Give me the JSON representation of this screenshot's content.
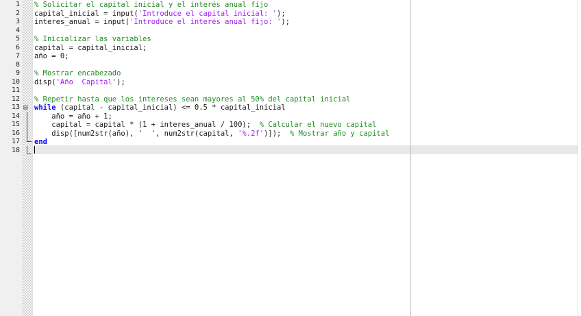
{
  "editor": {
    "line_numbers": [
      "1",
      "2",
      "3",
      "4",
      "5",
      "6",
      "7",
      "8",
      "9",
      "10",
      "11",
      "12",
      "13",
      "14",
      "15",
      "16",
      "17",
      "18"
    ],
    "current_line": "18",
    "lines": [
      [
        {
          "t": "comment",
          "v": "% Solicitar el capital inicial y el interés anual fijo"
        }
      ],
      [
        {
          "t": "text",
          "v": "capital_inicial = input("
        },
        {
          "t": "string",
          "v": "'Introduce el capital inicial: '"
        },
        {
          "t": "text",
          "v": ");"
        }
      ],
      [
        {
          "t": "text",
          "v": "interes_anual = input("
        },
        {
          "t": "string",
          "v": "'Introduce el interés anual fijo: '"
        },
        {
          "t": "text",
          "v": ");"
        }
      ],
      [],
      [
        {
          "t": "comment",
          "v": "% Inicializar las variables"
        }
      ],
      [
        {
          "t": "text",
          "v": "capital = capital_inicial;"
        }
      ],
      [
        {
          "t": "text",
          "v": "año = 0;"
        }
      ],
      [],
      [
        {
          "t": "comment",
          "v": "% Mostrar encabezado"
        }
      ],
      [
        {
          "t": "text",
          "v": "disp("
        },
        {
          "t": "string",
          "v": "'Año  Capital'"
        },
        {
          "t": "text",
          "v": ");"
        }
      ],
      [],
      [
        {
          "t": "comment",
          "v": "% Repetir hasta que los intereses sean mayores al 50% del capital inicial"
        }
      ],
      [
        {
          "t": "keyword",
          "v": "while"
        },
        {
          "t": "text",
          "v": " (capital - capital_inicial) <= 0.5 * capital_inicial"
        }
      ],
      [
        {
          "t": "text",
          "v": "    año = año + 1;"
        }
      ],
      [
        {
          "t": "text",
          "v": "    capital = capital * (1 + interes_anual / 100);  "
        },
        {
          "t": "comment",
          "v": "% Calcular el nuevo capital"
        }
      ],
      [
        {
          "t": "text",
          "v": "    disp([num2str(año), '  ', num2str(capital, "
        },
        {
          "t": "string",
          "v": "'%.2f'"
        },
        {
          "t": "text",
          "v": ")]);  "
        },
        {
          "t": "comment",
          "v": "% Mostrar año y capital"
        }
      ],
      [
        {
          "t": "keyword",
          "v": "end"
        }
      ],
      []
    ]
  },
  "fold_gutter": {
    "collapse_icon": "minus-box-icon",
    "marker_glyph": "⊟"
  }
}
